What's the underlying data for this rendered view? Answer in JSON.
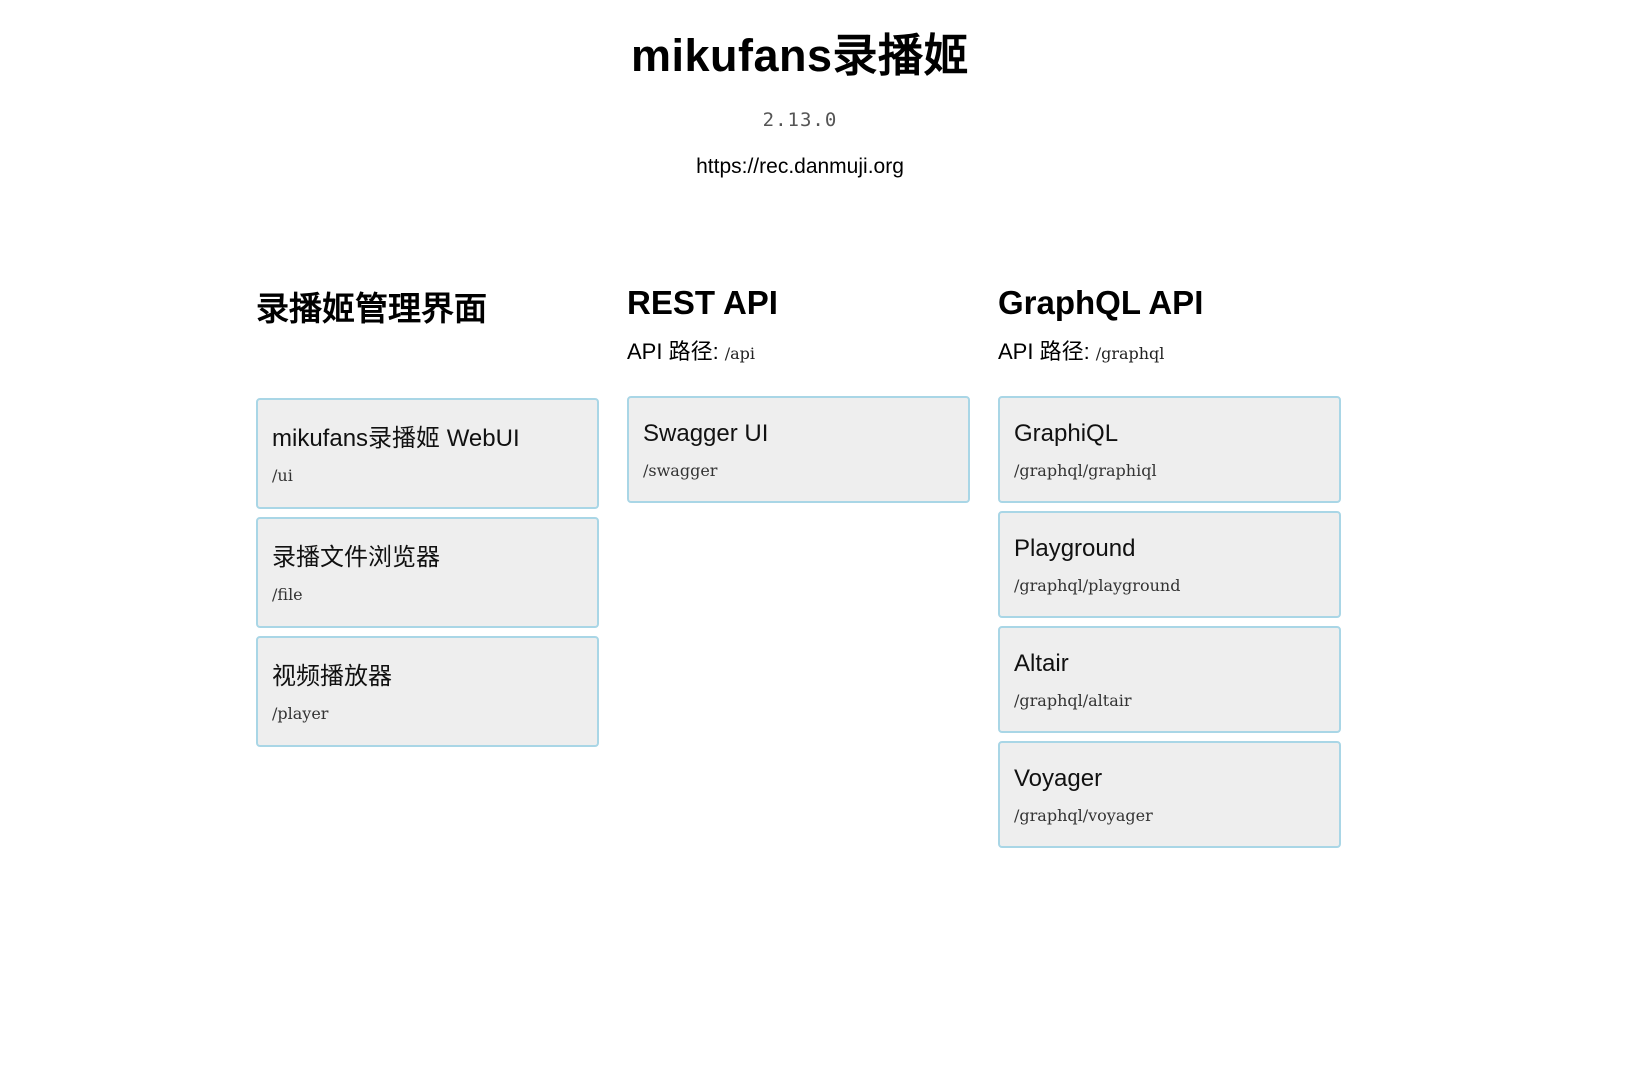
{
  "header": {
    "title": "mikufans录播姬",
    "version": "2.13.0",
    "url": "https://rec.danmuji.org"
  },
  "sections": [
    {
      "title": "录播姬管理界面",
      "links": [
        {
          "name": "mikufans录播姬 WebUI",
          "path": "/ui"
        },
        {
          "name": "录播文件浏览器",
          "path": "/file"
        },
        {
          "name": "视频播放器",
          "path": "/player"
        }
      ]
    },
    {
      "title": "REST API",
      "api_path_label": "API 路径:",
      "api_path": "/api",
      "links": [
        {
          "name": "Swagger UI",
          "path": "/swagger"
        }
      ]
    },
    {
      "title": "GraphQL API",
      "api_path_label": "API 路径:",
      "api_path": "/graphql",
      "links": [
        {
          "name": "GraphiQL",
          "path": "/graphql/graphiql"
        },
        {
          "name": "Playground",
          "path": "/graphql/playground"
        },
        {
          "name": "Altair",
          "path": "/graphql/altair"
        },
        {
          "name": "Voyager",
          "path": "/graphql/voyager"
        }
      ]
    }
  ],
  "colors": {
    "card_background": "#eeeeee",
    "card_border": "#a9d6e6"
  }
}
